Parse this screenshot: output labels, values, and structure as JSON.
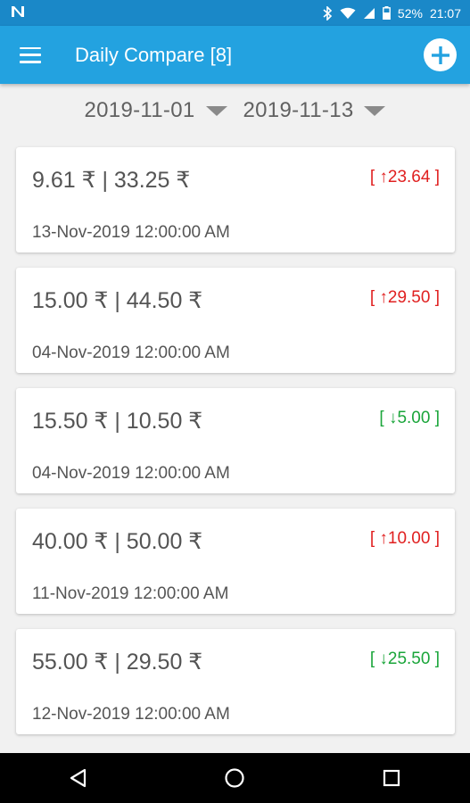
{
  "statusbar": {
    "battery": "52%",
    "time": "21:07"
  },
  "appbar": {
    "title": "Daily Compare [8]"
  },
  "filters": {
    "start_date": "2019-11-01",
    "end_date": "2019-11-13"
  },
  "items": [
    {
      "prices": "9.61 ₹ | 33.25 ₹",
      "change": "[ ↑23.64 ]",
      "direction": "up",
      "date": "13-Nov-2019 12:00:00 AM"
    },
    {
      "prices": "15.00 ₹ | 44.50 ₹",
      "change": "[ ↑29.50 ]",
      "direction": "up",
      "date": "04-Nov-2019 12:00:00 AM"
    },
    {
      "prices": "15.50 ₹ | 10.50 ₹",
      "change": "[ ↓5.00 ]",
      "direction": "down",
      "date": "04-Nov-2019 12:00:00 AM"
    },
    {
      "prices": "40.00 ₹ | 50.00 ₹",
      "change": "[ ↑10.00 ]",
      "direction": "up",
      "date": "11-Nov-2019 12:00:00 AM"
    },
    {
      "prices": "55.00 ₹ | 29.50 ₹",
      "change": "[ ↓25.50 ]",
      "direction": "down",
      "date": "12-Nov-2019 12:00:00 AM"
    }
  ],
  "colors": {
    "statusbar": "#1a88c8",
    "appbar": "#23a2e0",
    "up": "#e02020",
    "down": "#1aa53a"
  }
}
